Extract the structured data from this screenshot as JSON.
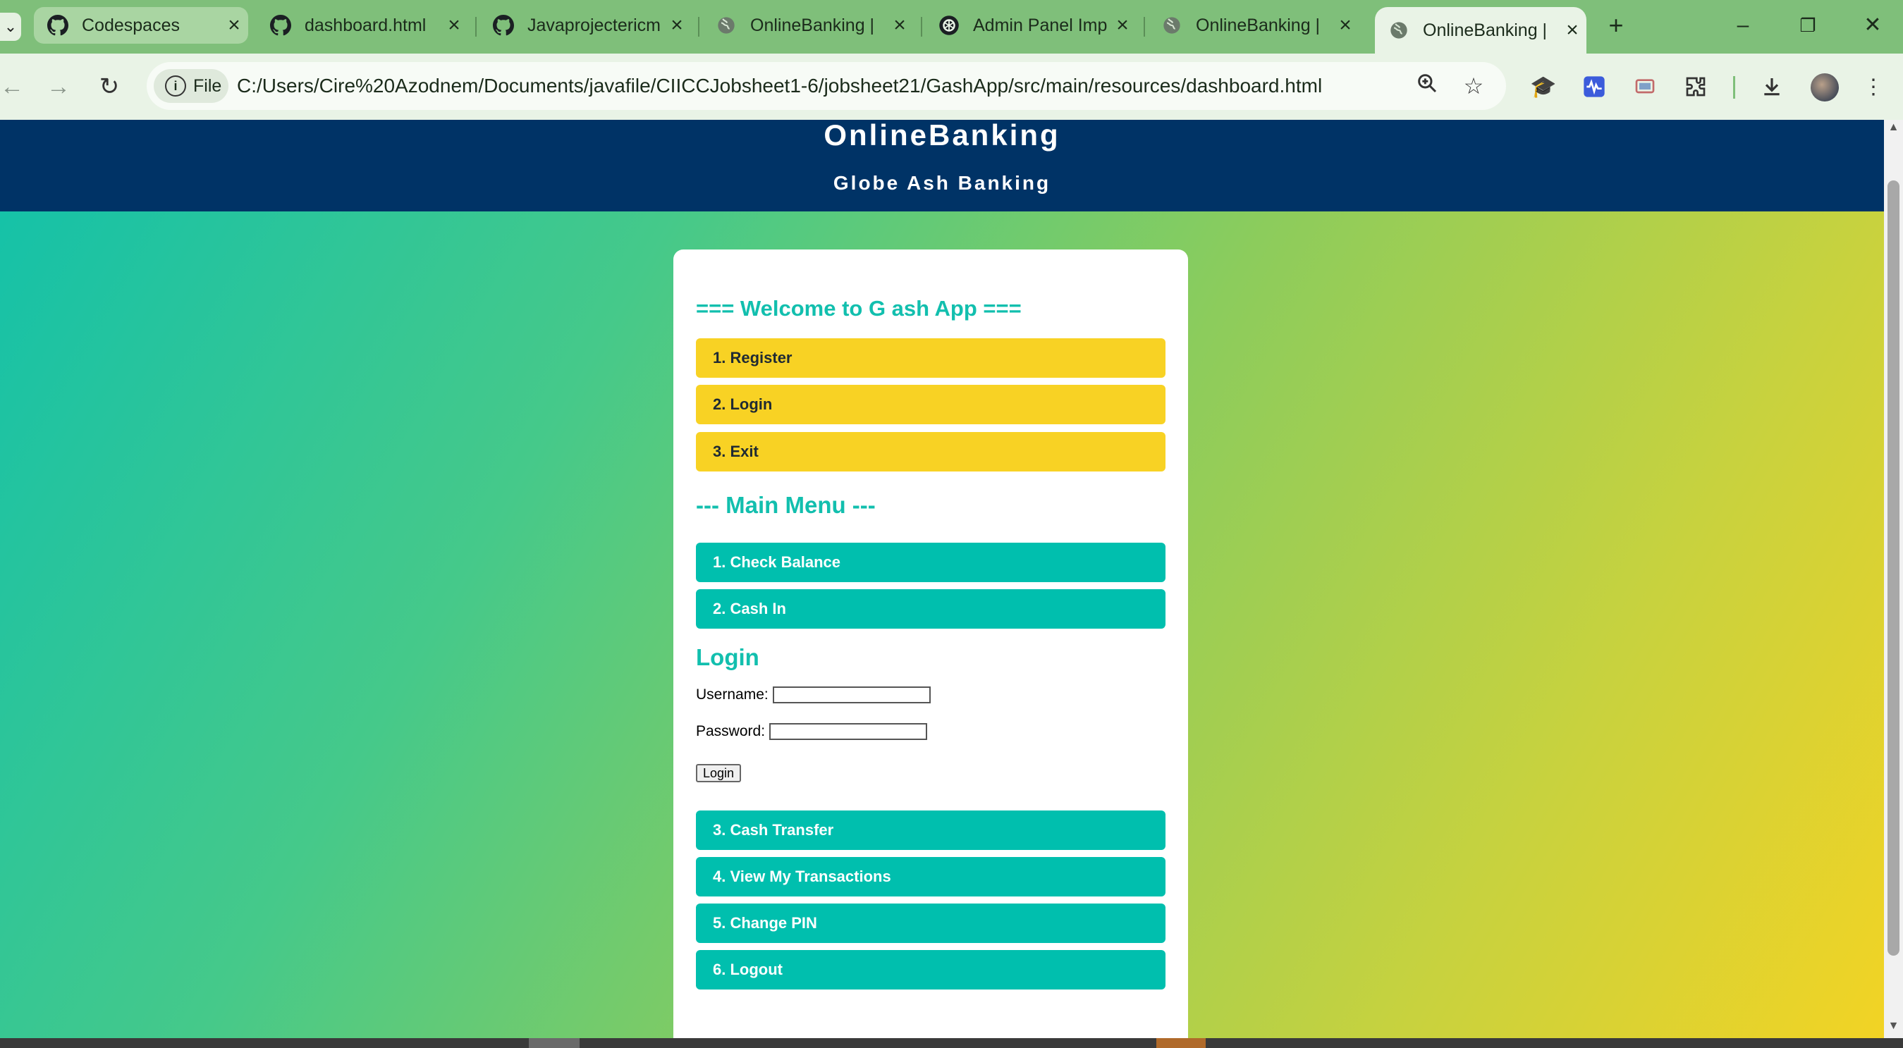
{
  "browser": {
    "tabs": [
      {
        "label": "Codespaces",
        "icon": "github-icon"
      },
      {
        "label": "dashboard.html",
        "icon": "github-icon"
      },
      {
        "label": "Javaprojectericm",
        "icon": "github-icon"
      },
      {
        "label": "OnlineBanking |",
        "icon": "globe-icon"
      },
      {
        "label": "Admin Panel Imp",
        "icon": "openai-icon"
      },
      {
        "label": "OnlineBanking |",
        "icon": "globe-icon"
      },
      {
        "label": "OnlineBanking |",
        "icon": "globe-icon",
        "active": true
      }
    ],
    "address_chip": "File",
    "url": "C:/Users/Cire%20Azodnem/Documents/javafile/CIICCJobsheet1-6/jobsheet21/GashApp/src/main/resources/dashboard.html"
  },
  "page": {
    "header_title": "OnlineBanking",
    "header_subtitle": "Globe Ash Banking",
    "welcome_heading": "=== Welcome to G ash App ===",
    "welcome_buttons": [
      "1. Register",
      "2. Login",
      "3. Exit"
    ],
    "main_menu_heading": "--- Main Menu ---",
    "main_buttons_top": [
      "1. Check Balance",
      "2. Cash In"
    ],
    "login": {
      "heading": "Login",
      "username_label": "Username:",
      "username_value": "",
      "password_label": "Password:",
      "password_value": "",
      "submit_label": "Login"
    },
    "main_buttons_bottom": [
      "3. Cash Transfer",
      "4. View My Transactions",
      "5. Change PIN",
      "6. Logout"
    ]
  },
  "colors": {
    "header_bg": "#003366",
    "accent_teal": "#00bfae",
    "accent_yellow": "#f8d224"
  }
}
